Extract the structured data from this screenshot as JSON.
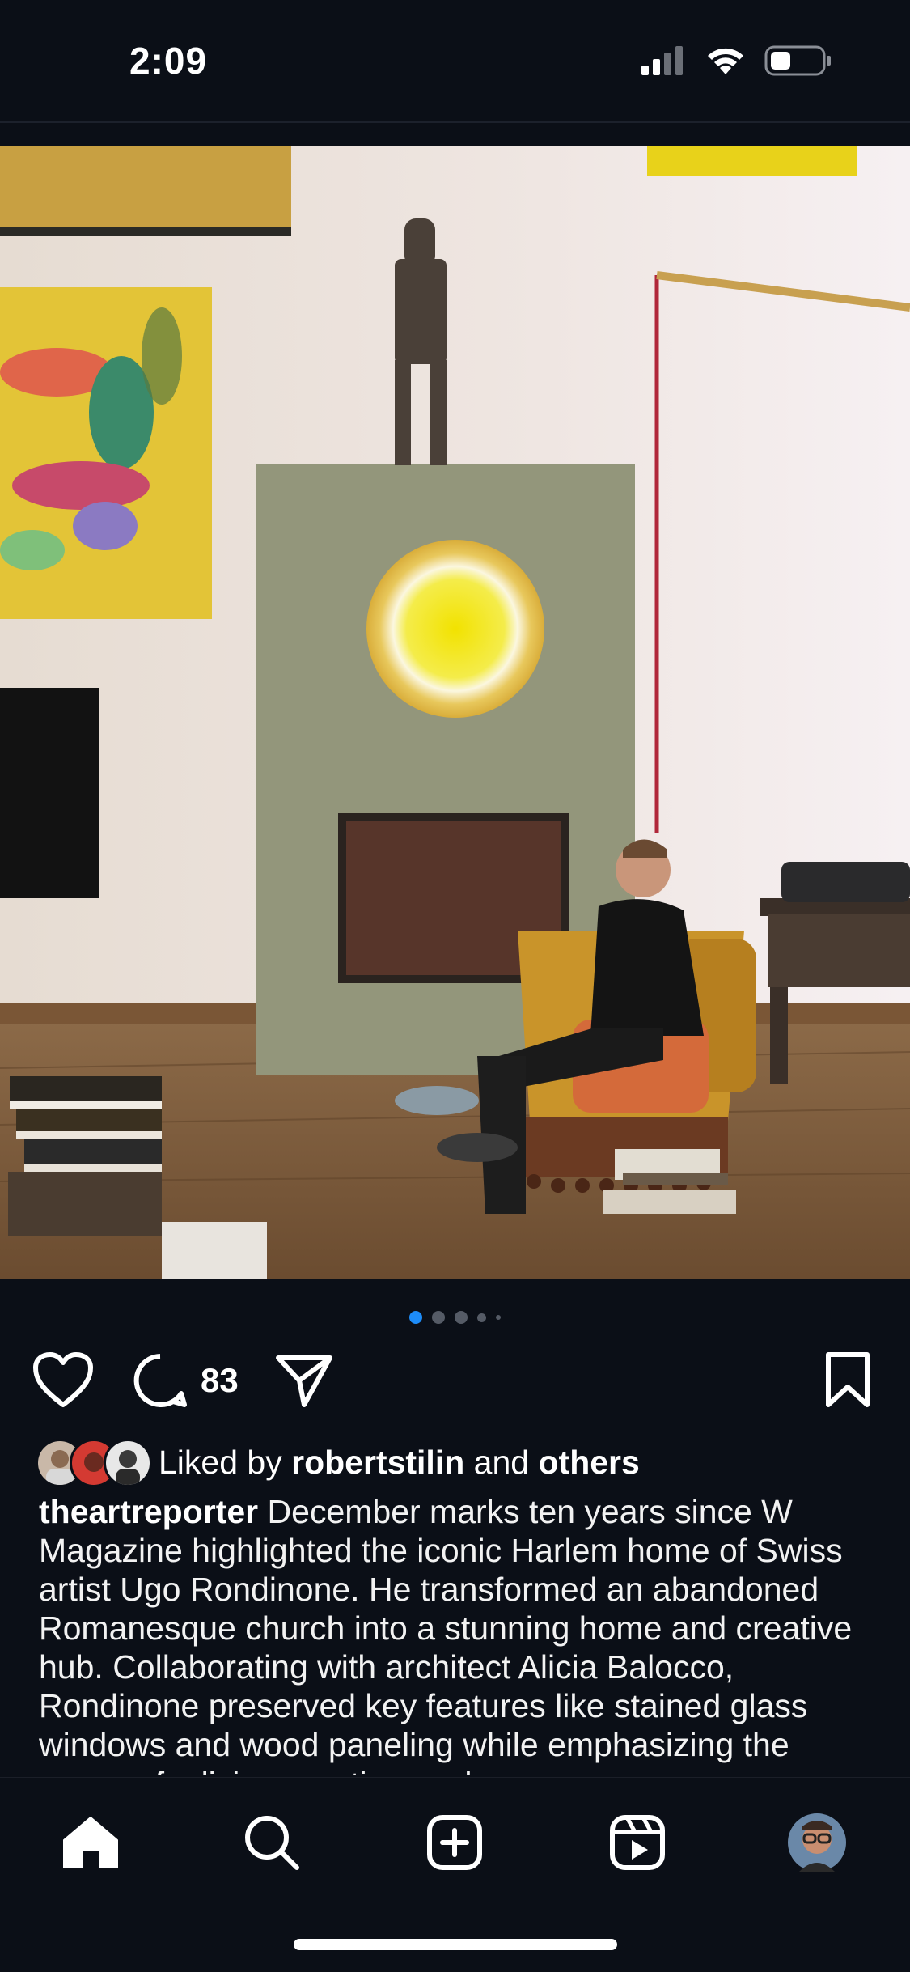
{
  "status_bar": {
    "time": "2:09"
  },
  "post": {
    "carousel": {
      "total": 5,
      "active_index": 0
    },
    "comment_count": "83",
    "liked_by": {
      "prefix": "Liked by",
      "user": "robertstilin",
      "middle": "and",
      "others": "others"
    },
    "caption": {
      "username": "theartreporter",
      "text": "December marks ten years since W Magazine highlighted the iconic Harlem home of Swiss artist Ugo Rondinone. He transformed an abandoned Romanesque church into a stunning home and creative hub. Collaborating with architect Alicia Balocco, Rondinone preserved key features like stained glass windows and wood paneling while emphasizing the sense of a living creative work..."
    }
  },
  "tabbar": {
    "items": [
      "home-icon",
      "search-icon",
      "create-icon",
      "reels-icon",
      "profile-avatar"
    ],
    "active": "home-icon"
  },
  "colors": {
    "background": "#0b0f17",
    "accent": "#1d8cf8",
    "text": "#ffffff"
  }
}
